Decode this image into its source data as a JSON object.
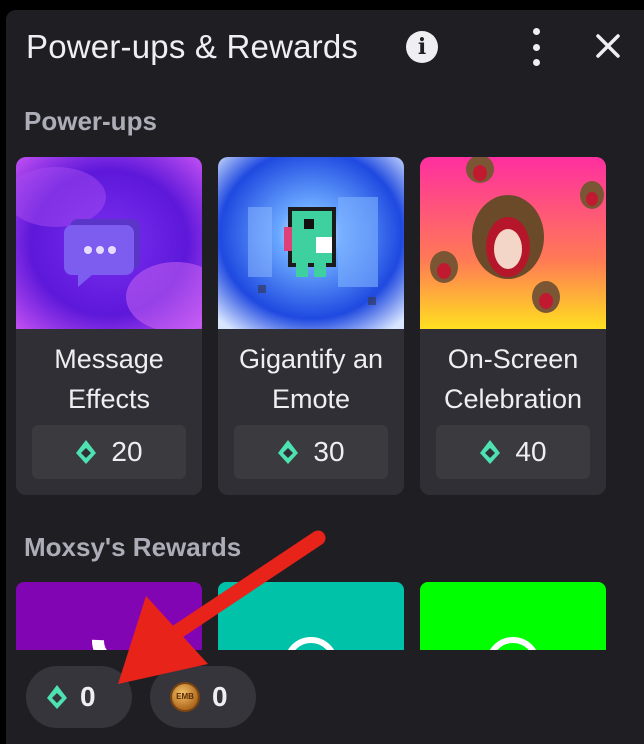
{
  "header": {
    "title": "Power-ups & Rewards",
    "info_icon": "info-icon",
    "menu_icon": "kebab-menu-icon",
    "close_icon": "close-icon"
  },
  "sections": {
    "powerups_title": "Power-ups",
    "rewards_title": "Moxsy's Rewards"
  },
  "powerups": [
    {
      "label_line1": "Message",
      "label_line2": "Effects",
      "cost": "20"
    },
    {
      "label_line1": "Gigantify an",
      "label_line2": "Emote",
      "cost": "30"
    },
    {
      "label_line1": "On-Screen",
      "label_line2": "Celebration",
      "cost": "40"
    }
  ],
  "rewards_tiles_colors": [
    "#8205b4",
    "#00c2a8",
    "#00ff00"
  ],
  "balances": {
    "gems": "0",
    "coins": "0",
    "coin_icon_text": "EMB"
  },
  "colors": {
    "panel_bg": "#1f1f23",
    "card_bg": "#2f2f35",
    "accent_gem": "#4ee2b0",
    "annotation_arrow": "#e8231a"
  }
}
